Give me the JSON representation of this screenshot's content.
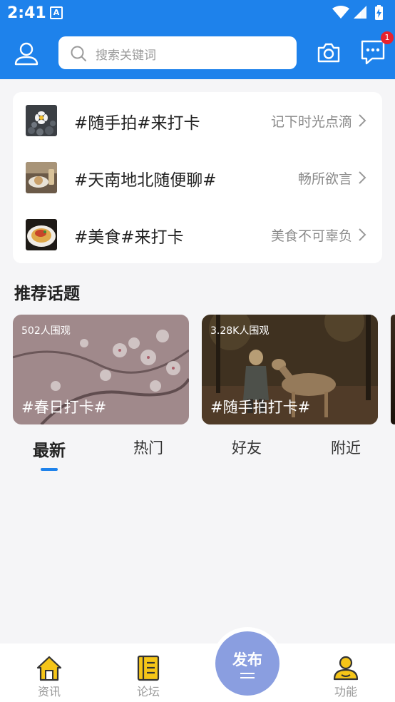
{
  "status_bar": {
    "time": "2:41",
    "notification_icon": "A"
  },
  "search": {
    "placeholder": "搜索关键词"
  },
  "messages": {
    "badge_count": "1"
  },
  "topics": [
    {
      "title": "#随手拍#来打卡",
      "desc": "记下时光点滴",
      "thumb": "flower-photo"
    },
    {
      "title": "#天南地北随便聊#",
      "desc": "畅所欲言",
      "thumb": "cafe-photo"
    },
    {
      "title": "#美食#来打卡",
      "desc": "美食不可辜负",
      "thumb": "pasta-photo"
    }
  ],
  "recommended": {
    "title": "推荐话题",
    "items": [
      {
        "views": "502人围观",
        "title": "#春日打卡#",
        "image": "cherry-blossom-photo"
      },
      {
        "views": "3.28K人围观",
        "title": "#随手拍打卡#",
        "image": "girl-and-deer-photo"
      }
    ]
  },
  "tabs": [
    {
      "label": "最新",
      "active": true
    },
    {
      "label": "热门",
      "active": false
    },
    {
      "label": "好友",
      "active": false
    },
    {
      "label": "附近",
      "active": false
    }
  ],
  "bottom_nav": {
    "items": [
      {
        "label": "资讯",
        "icon": "home-icon"
      },
      {
        "label": "论坛",
        "icon": "forum-icon"
      },
      {
        "label": "功能",
        "icon": "profile-icon"
      }
    ],
    "publish_label": "发布"
  },
  "colors": {
    "primary": "#1e82eb",
    "badge": "#e8222d",
    "publish": "#8a9ee0",
    "nav_icon": "#f5c518"
  }
}
